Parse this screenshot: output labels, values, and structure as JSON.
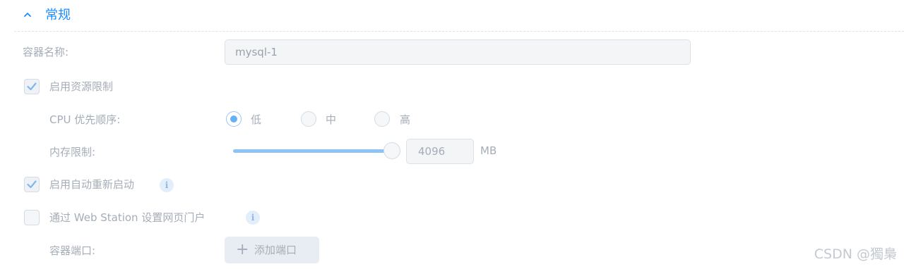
{
  "section": {
    "title": "常规",
    "collapse_icon": "chevron-up-icon"
  },
  "container_name": {
    "label": "容器名称:",
    "value": "mysql-1"
  },
  "resource_limit": {
    "label": "启用资源限制",
    "checked": true
  },
  "cpu_priority": {
    "label": "CPU 优先顺序:",
    "options": [
      "低",
      "中",
      "高"
    ],
    "selected": "低"
  },
  "memory_limit": {
    "label": "内存限制:",
    "value": "4096",
    "unit": "MB",
    "slider_fraction": 1.0
  },
  "auto_restart": {
    "label": "启用自动重新启动",
    "checked": true,
    "info_icon": "info-icon"
  },
  "web_station": {
    "label": "通过 Web Station 设置网页门户",
    "checked": false,
    "info_icon": "info-icon"
  },
  "container_port": {
    "label": "容器端口:",
    "add_button": "添加端口",
    "add_icon": "plus-icon"
  },
  "watermark": "CSDN @獨梟",
  "colors": {
    "accent": "#1a8cff",
    "slider": "#8ec3f5",
    "muted_text": "#a5adb8"
  }
}
